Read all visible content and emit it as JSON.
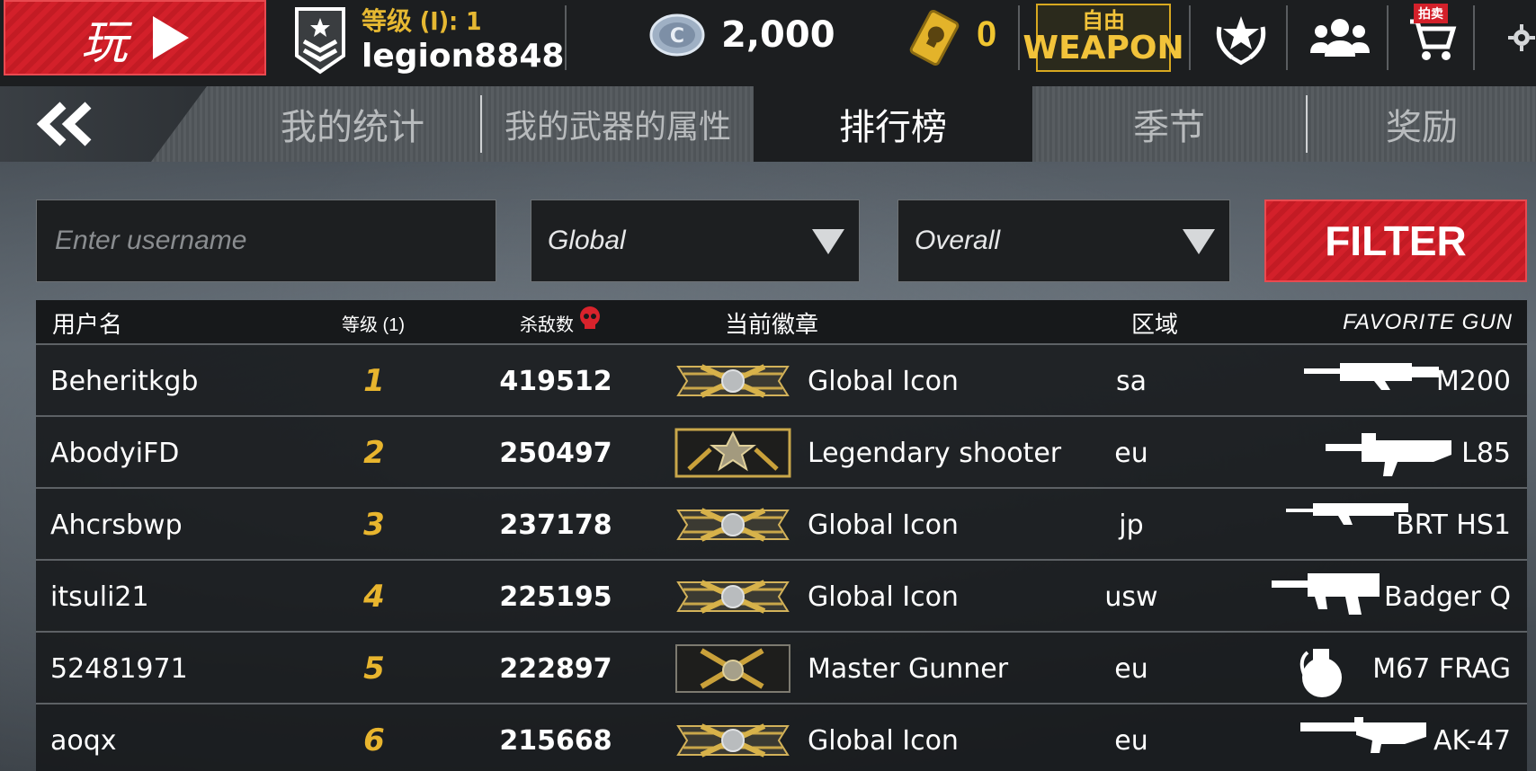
{
  "header": {
    "play_label": "玩",
    "level_label": "等级 (I): 1",
    "username": "legion8848",
    "coins": "2,000",
    "gold": "0",
    "weapon_btn": {
      "cn": "自由",
      "en": "WEAPON"
    },
    "auction_tag": "拍卖"
  },
  "tabs": [
    {
      "label": "我的统计",
      "active": false
    },
    {
      "label": "我的武器的属性",
      "active": false
    },
    {
      "label": "排行榜",
      "active": true
    },
    {
      "label": "季节",
      "active": false
    },
    {
      "label": "奖励",
      "active": false
    }
  ],
  "filters": {
    "username_placeholder": "Enter username",
    "region_selected": "Global",
    "period_selected": "Overall",
    "filter_label": "FILTER"
  },
  "table": {
    "headers": {
      "username": "用户名",
      "level": "等级 (1)",
      "kills": "杀敌数",
      "badge": "当前徽章",
      "region": "区域",
      "gun": "FAVORITE GUN"
    },
    "rows": [
      {
        "username": "Beheritkgb",
        "rank": "1",
        "kills": "419512",
        "badge": "Global Icon",
        "region": "sa",
        "gun": "M200"
      },
      {
        "username": "AbodyiFD",
        "rank": "2",
        "kills": "250497",
        "badge": "Legendary shooter",
        "region": "eu",
        "gun": "L85"
      },
      {
        "username": "Ahcrsbwp",
        "rank": "3",
        "kills": "237178",
        "badge": "Global Icon",
        "region": "jp",
        "gun": "BRT HS1"
      },
      {
        "username": "itsuli21",
        "rank": "4",
        "kills": "225195",
        "badge": "Global Icon",
        "region": "usw",
        "gun": "Badger Q"
      },
      {
        "username": "52481971",
        "rank": "5",
        "kills": "222897",
        "badge": "Master Gunner",
        "region": "eu",
        "gun": "M67 FRAG"
      },
      {
        "username": "aoqx",
        "rank": "6",
        "kills": "215668",
        "badge": "Global Icon",
        "region": "eu",
        "gun": "AK-47"
      }
    ]
  },
  "colors": {
    "accent_red": "#d3202a",
    "gold": "#e8b52e"
  }
}
